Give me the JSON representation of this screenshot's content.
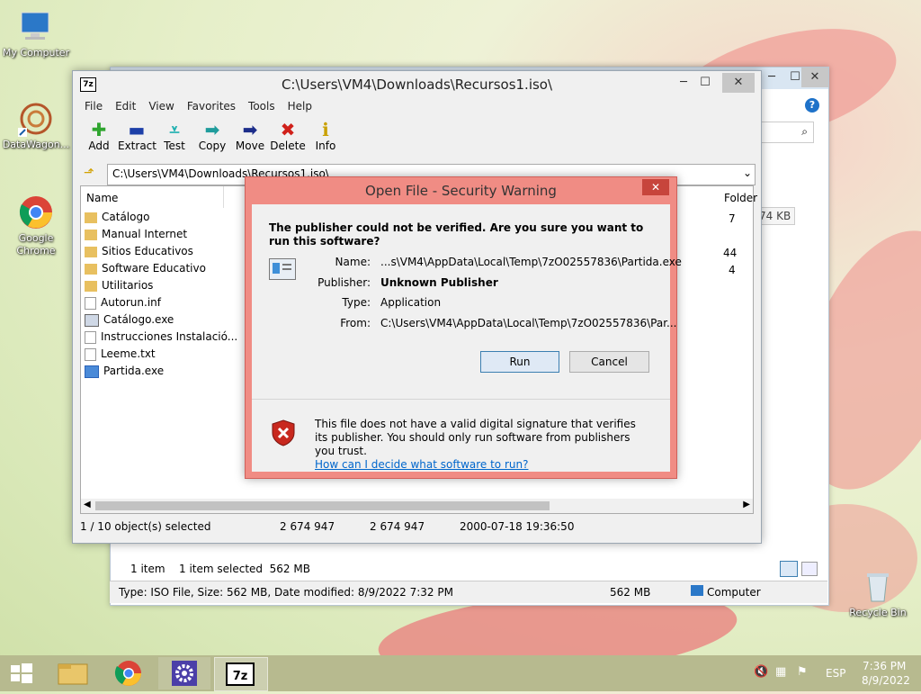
{
  "desktop": {
    "icons": [
      {
        "label": "My Computer"
      },
      {
        "label": "DataWagon..."
      },
      {
        "label": "Google Chrome"
      },
      {
        "label": "Recycle Bin"
      }
    ]
  },
  "explorer": {
    "status_items": "1 item",
    "status_selected": "1 item selected  562 MB",
    "bottom_info": "Type: ISO File, Size: 562 MB, Date modified: 8/9/2022 7:32 PM",
    "bottom_size": "562 MB",
    "bottom_location": "Computer",
    "size_cell": "74 KB"
  },
  "zip": {
    "title": "C:\\Users\\VM4\\Downloads\\Recursos1.iso\\",
    "menu": [
      "File",
      "Edit",
      "View",
      "Favorites",
      "Tools",
      "Help"
    ],
    "toolbar": [
      {
        "label": "Add",
        "icon": "plus-icon"
      },
      {
        "label": "Extract",
        "icon": "minus-icon"
      },
      {
        "label": "Test",
        "icon": "check-icon"
      },
      {
        "label": "Copy",
        "icon": "arrow-right-icon"
      },
      {
        "label": "Move",
        "icon": "arrow-right-icon"
      },
      {
        "label": "Delete",
        "icon": "x-icon"
      },
      {
        "label": "Info",
        "icon": "info-icon"
      }
    ],
    "address": "C:\\Users\\VM4\\Downloads\\Recursos1.iso\\",
    "columns": {
      "name": "Name",
      "folders": "Folder"
    },
    "rows": [
      {
        "name": "Catálogo",
        "type": "folder",
        "extra": "7"
      },
      {
        "name": "Manual Internet",
        "type": "folder",
        "extra": ""
      },
      {
        "name": "Sitios Educativos",
        "type": "folder",
        "extra": "44"
      },
      {
        "name": "Software Educativo",
        "type": "folder",
        "extra": "4"
      },
      {
        "name": "Utilitarios",
        "type": "folder",
        "extra": ""
      },
      {
        "name": "Autorun.inf",
        "type": "file",
        "extra": ""
      },
      {
        "name": "Catálogo.exe",
        "type": "exe",
        "extra": ""
      },
      {
        "name": "Instrucciones Instalació...",
        "type": "file",
        "extra": ""
      },
      {
        "name": "Leeme.txt",
        "type": "file",
        "extra": ""
      },
      {
        "name": "Partida.exe",
        "type": "exe-selected",
        "extra": ""
      }
    ],
    "status": {
      "selected": "1 / 10 object(s) selected",
      "size": "2 674 947",
      "packed": "2 674 947",
      "date": "2000-07-18 19:36:50"
    }
  },
  "dialog": {
    "title": "Open File - Security Warning",
    "question": "The publisher could not be verified.  Are you sure you want to run this software?",
    "fields": [
      {
        "key": "Name:",
        "value": "...s\\VM4\\AppData\\Local\\Temp\\7zO02557836\\Partida.exe",
        "bold": false
      },
      {
        "key": "Publisher:",
        "value": "Unknown Publisher",
        "bold": true
      },
      {
        "key": "Type:",
        "value": "Application",
        "bold": false
      },
      {
        "key": "From:",
        "value": "C:\\Users\\VM4\\AppData\\Local\\Temp\\7zO02557836\\Par...",
        "bold": false
      }
    ],
    "run_label": "Run",
    "cancel_label": "Cancel",
    "warning_text": "This file does not have a valid digital signature that verifies its publisher.  You should only run software from publishers you trust.",
    "link_text": "How can I decide what software to run?"
  },
  "taskbar": {
    "language": "ESP",
    "time": "7:36 PM",
    "date": "8/9/2022"
  }
}
